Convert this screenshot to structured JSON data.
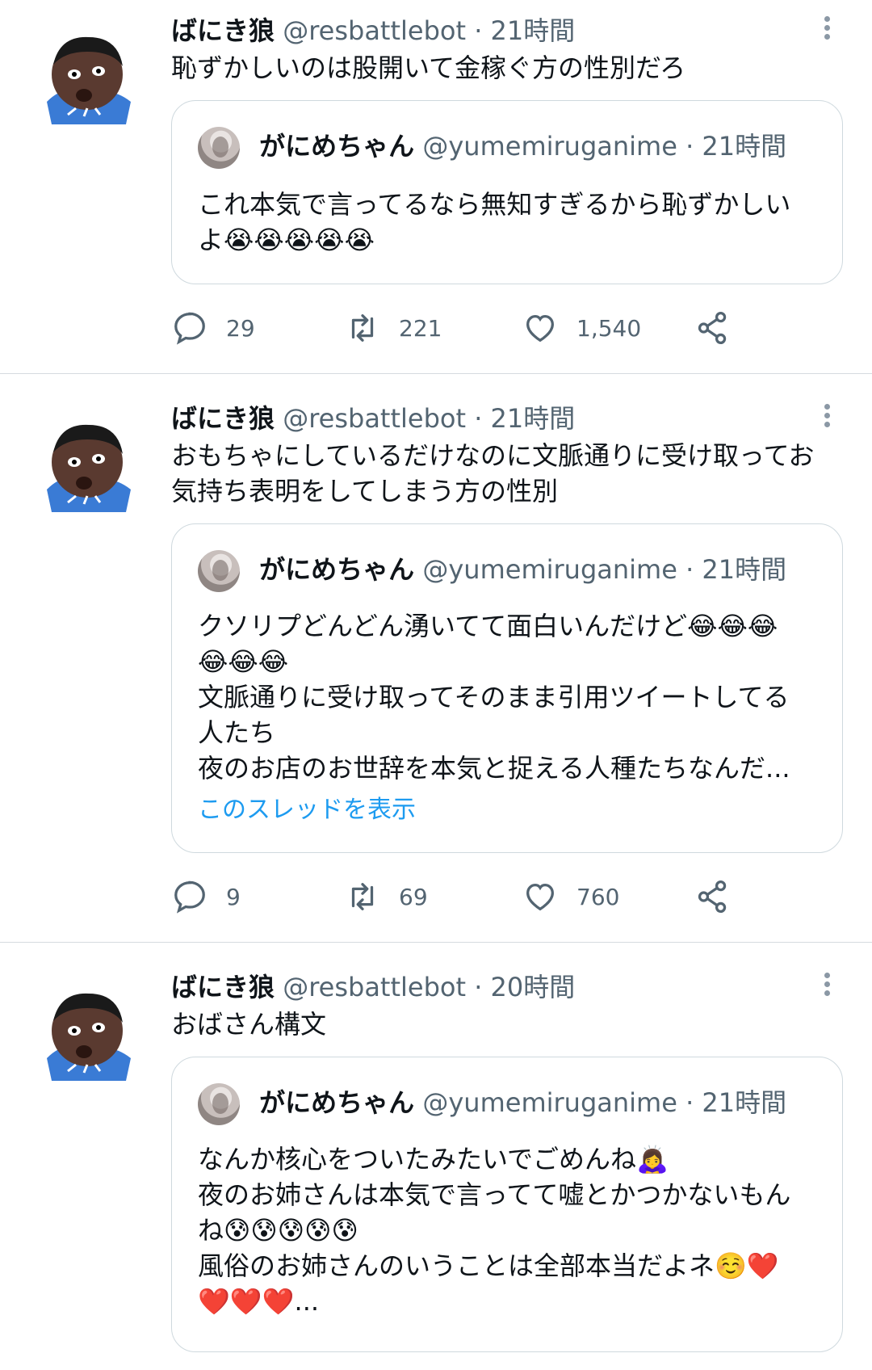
{
  "tweets": [
    {
      "author_name": "ばにき狼",
      "author_meta": "@resbattlebot · 21時間",
      "text": "恥ずかしいのは股開いて金稼ぐ方の性別だろ",
      "quote": {
        "name": "がにめちゃん",
        "meta": "@yumemiruganime · 21時間",
        "text": "これ本気で言ってるなら無知すぎるから恥ずかしい\nよ😭😭😭😭😭"
      },
      "replies": "29",
      "retweets": "221",
      "likes": "1,540"
    },
    {
      "author_name": "ばにき狼",
      "author_meta": "@resbattlebot · 21時間",
      "text": "おもちゃにしているだけなのに文脈通りに受け取ってお\n気持ち表明をしてしまう方の性別",
      "quote": {
        "name": "がにめちゃん",
        "meta": "@yumemiruganime · 21時間",
        "text": "クソリプどんどん湧いてて面白いんだけど😂😂😂\n😂😂😂\n文脈通りに受け取ってそのまま引用ツイートしてる\n人たち\n夜のお店のお世辞を本気と捉える人種たちなんだ...",
        "link": "このスレッドを表示"
      },
      "replies": "9",
      "retweets": "69",
      "likes": "760"
    },
    {
      "author_name": "ばにき狼",
      "author_meta": "@resbattlebot · 20時間",
      "text": "おばさん構文",
      "quote": {
        "name": "がにめちゃん",
        "meta": "@yumemiruganime · 21時間",
        "text": "なんか核心をついたみたいでごめんね🙇‍♀️\n夜のお姉さんは本気で言ってて嘘とかつかないもん\nね😰😰😰😰😰\n風俗のお姉さんのいうことは全部本当だよネ☺️❤️\n❤️❤️❤️..."
      }
    }
  ],
  "icons": {
    "reply": "speech-bubble-icon",
    "retweet": "retweet-arrows-icon",
    "like": "heart-icon",
    "share": "share-icon",
    "more": "vertical-dots-icon"
  },
  "colors": {
    "text": "#0f1419",
    "secondary": "#536471",
    "link": "#1d9bf0",
    "border": "#cfd9de"
  }
}
